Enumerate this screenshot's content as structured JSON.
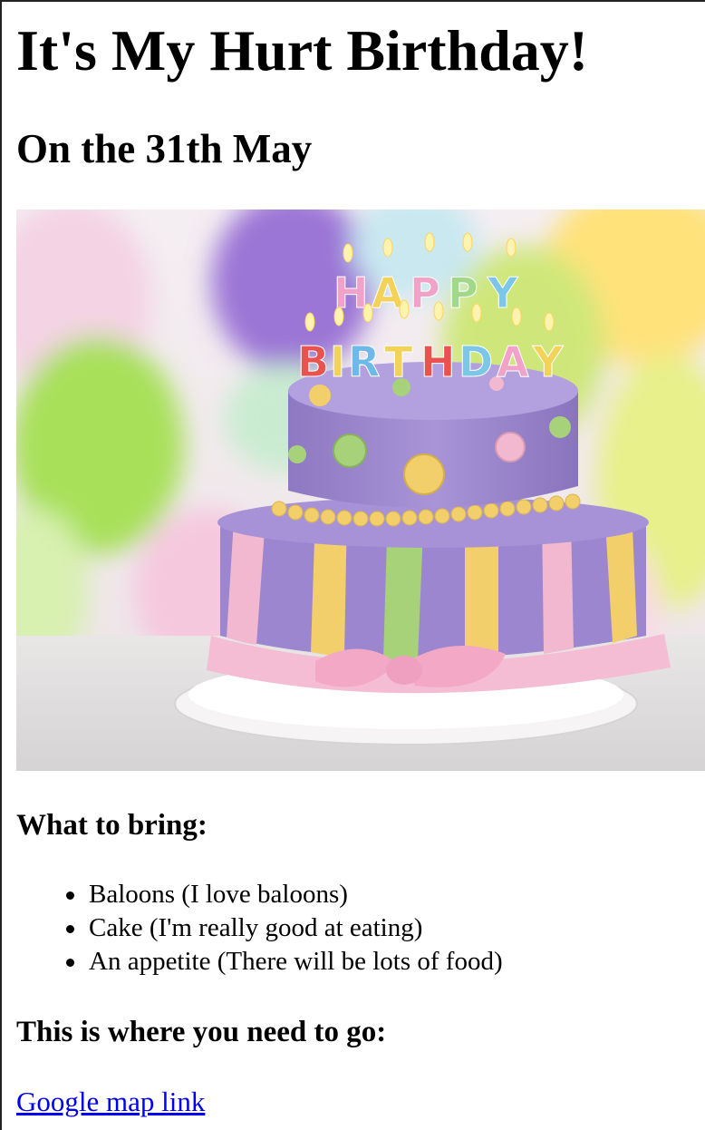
{
  "page": {
    "title": "It's My Hurt Birthday!",
    "date_heading": "On the 31th May"
  },
  "hero_image": {
    "alt": "Birthday cake with candles",
    "candle_letters_top": "HAPPY",
    "candle_letters_bottom": "BIRTHDAY"
  },
  "bring": {
    "heading": "What to bring:",
    "items": [
      "Baloons (I love baloons)",
      "Cake (I'm really good at eating)",
      "An appetite (There will be lots of food)"
    ]
  },
  "location": {
    "heading": "This is where you need to go:",
    "link_text": "Google map link"
  },
  "colors": {
    "link": "#0000ee",
    "cake_purple": "#9b86cf",
    "cake_pink": "#f2b8cf",
    "cake_yellow": "#f2cf6a",
    "cake_green": "#a7d27a"
  }
}
